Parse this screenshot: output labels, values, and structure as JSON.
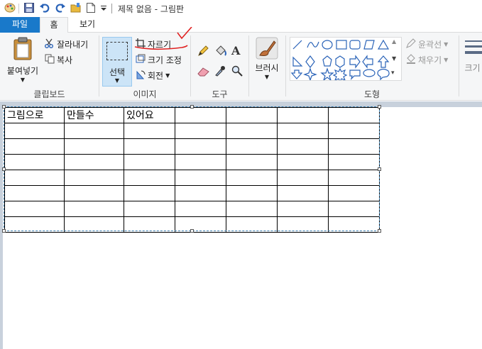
{
  "window": {
    "title": "제목 없음 - 그림판"
  },
  "tabs": [
    {
      "label": "파일"
    },
    {
      "label": "홈"
    },
    {
      "label": "보기"
    }
  ],
  "clipboard": {
    "paste": "붙여넣기",
    "cut": "잘라내기",
    "copy": "복사",
    "group": "클립보드"
  },
  "image": {
    "select": "선택",
    "crop": "자르기",
    "resize": "크기 조정",
    "rotate": "회전",
    "group": "이미지"
  },
  "tools": {
    "group": "도구"
  },
  "brushes": {
    "label": "브러시"
  },
  "shapes": {
    "outline": "윤곽선",
    "fill": "채우기",
    "group": "도형"
  },
  "size": {
    "label": "크기"
  },
  "table": {
    "rows": [
      [
        "그림으로",
        "만들수",
        "있어요",
        "",
        "",
        "",
        ""
      ],
      [
        "",
        "",
        "",
        "",
        "",
        "",
        ""
      ],
      [
        "",
        "",
        "",
        "",
        "",
        "",
        ""
      ],
      [
        "",
        "",
        "",
        "",
        "",
        "",
        ""
      ],
      [
        "",
        "",
        "",
        "",
        "",
        "",
        ""
      ],
      [
        "",
        "",
        "",
        "",
        "",
        "",
        ""
      ],
      [
        "",
        "",
        "",
        "",
        "",
        "",
        ""
      ],
      [
        "",
        "",
        "",
        "",
        "",
        "",
        ""
      ]
    ]
  },
  "colors": {
    "file_tab": "#1979ca",
    "annotation": "#e02020",
    "selection": "#cce4f7"
  }
}
